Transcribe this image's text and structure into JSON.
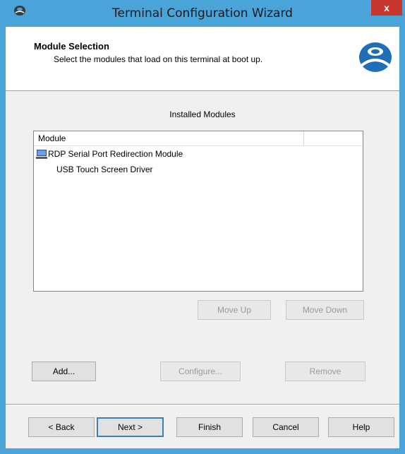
{
  "window": {
    "title": "Terminal Configuration Wizard",
    "close_glyph": "x"
  },
  "header": {
    "title": "Module Selection",
    "subtitle": "Select the modules that load on this terminal at boot up."
  },
  "modules": {
    "section_label": "Installed Modules",
    "column_header": "Module",
    "items": [
      {
        "label": "RDP Serial Port Redirection Module",
        "icon": "monitor-module-icon"
      },
      {
        "label": "USB Touch Screen Driver",
        "icon": ""
      }
    ]
  },
  "actions": {
    "move_up": "Move Up",
    "move_down": "Move Down",
    "add": "Add...",
    "configure": "Configure...",
    "remove": "Remove"
  },
  "footer": {
    "back": "< Back",
    "next": "Next >",
    "finish": "Finish",
    "cancel": "Cancel",
    "help": "Help"
  },
  "colors": {
    "titlebar": "#4aa3d9",
    "close": "#c7372f",
    "logo": "#1e6fb8"
  }
}
